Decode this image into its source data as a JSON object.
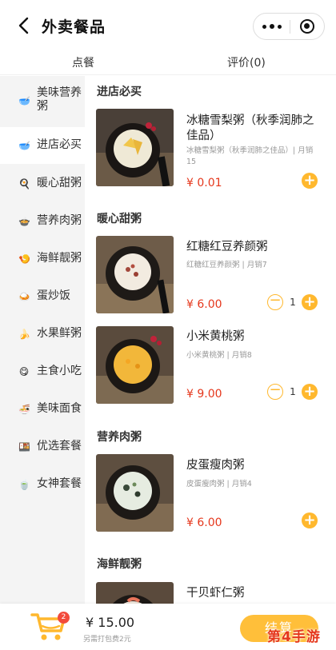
{
  "header": {
    "title": "外卖餐品"
  },
  "tabs": [
    {
      "label": "点餐"
    },
    {
      "label": "评价(0)"
    }
  ],
  "categories": [
    {
      "label": "美味营养粥",
      "icon": "🥣"
    },
    {
      "label": "进店必买",
      "icon": "🥣"
    },
    {
      "label": "暖心甜粥",
      "icon": "🍳"
    },
    {
      "label": "营养肉粥",
      "icon": "🍲"
    },
    {
      "label": "海鲜靓粥",
      "icon": "🍤"
    },
    {
      "label": "蛋炒饭",
      "icon": "🍛"
    },
    {
      "label": "水果鲜粥",
      "icon": "🍌"
    },
    {
      "label": "主食小吃",
      "icon": "😋"
    },
    {
      "label": "美味面食",
      "icon": "🍜"
    },
    {
      "label": "优选套餐",
      "icon": "🍱"
    },
    {
      "label": "女神套餐",
      "icon": "🍵"
    }
  ],
  "sections": [
    {
      "title": "进店必买"
    },
    {
      "title": "暖心甜粥"
    },
    {
      "title": "营养肉粥"
    },
    {
      "title": "海鲜靓粥"
    }
  ],
  "items": [
    {
      "name": "冰糖雪梨粥（秋季润肺之佳品）",
      "desc": "冰糖雪梨粥（秋季润肺之佳品）| 月销15",
      "price": "¥ 0.01"
    },
    {
      "name": "红糖红豆养颜粥",
      "desc": "红糖红豆养颜粥 | 月销7",
      "price": "¥ 6.00",
      "qty": "1"
    },
    {
      "name": "小米黄桃粥",
      "desc": "小米黄桃粥 | 月销8",
      "price": "¥ 9.00",
      "qty": "1"
    },
    {
      "name": "皮蛋瘦肉粥",
      "desc": "皮蛋瘦肉粥 | 月销4",
      "price": "¥ 6.00"
    },
    {
      "name": "干贝虾仁粥"
    }
  ],
  "cart": {
    "count": "2",
    "total": "¥ 15.00",
    "delivery": "另需打包费2元",
    "checkout": "结算"
  },
  "watermark": "第4手游",
  "colors": {
    "accent": "#ffb82e",
    "price": "#e5371c",
    "badge": "#f24a3b"
  }
}
